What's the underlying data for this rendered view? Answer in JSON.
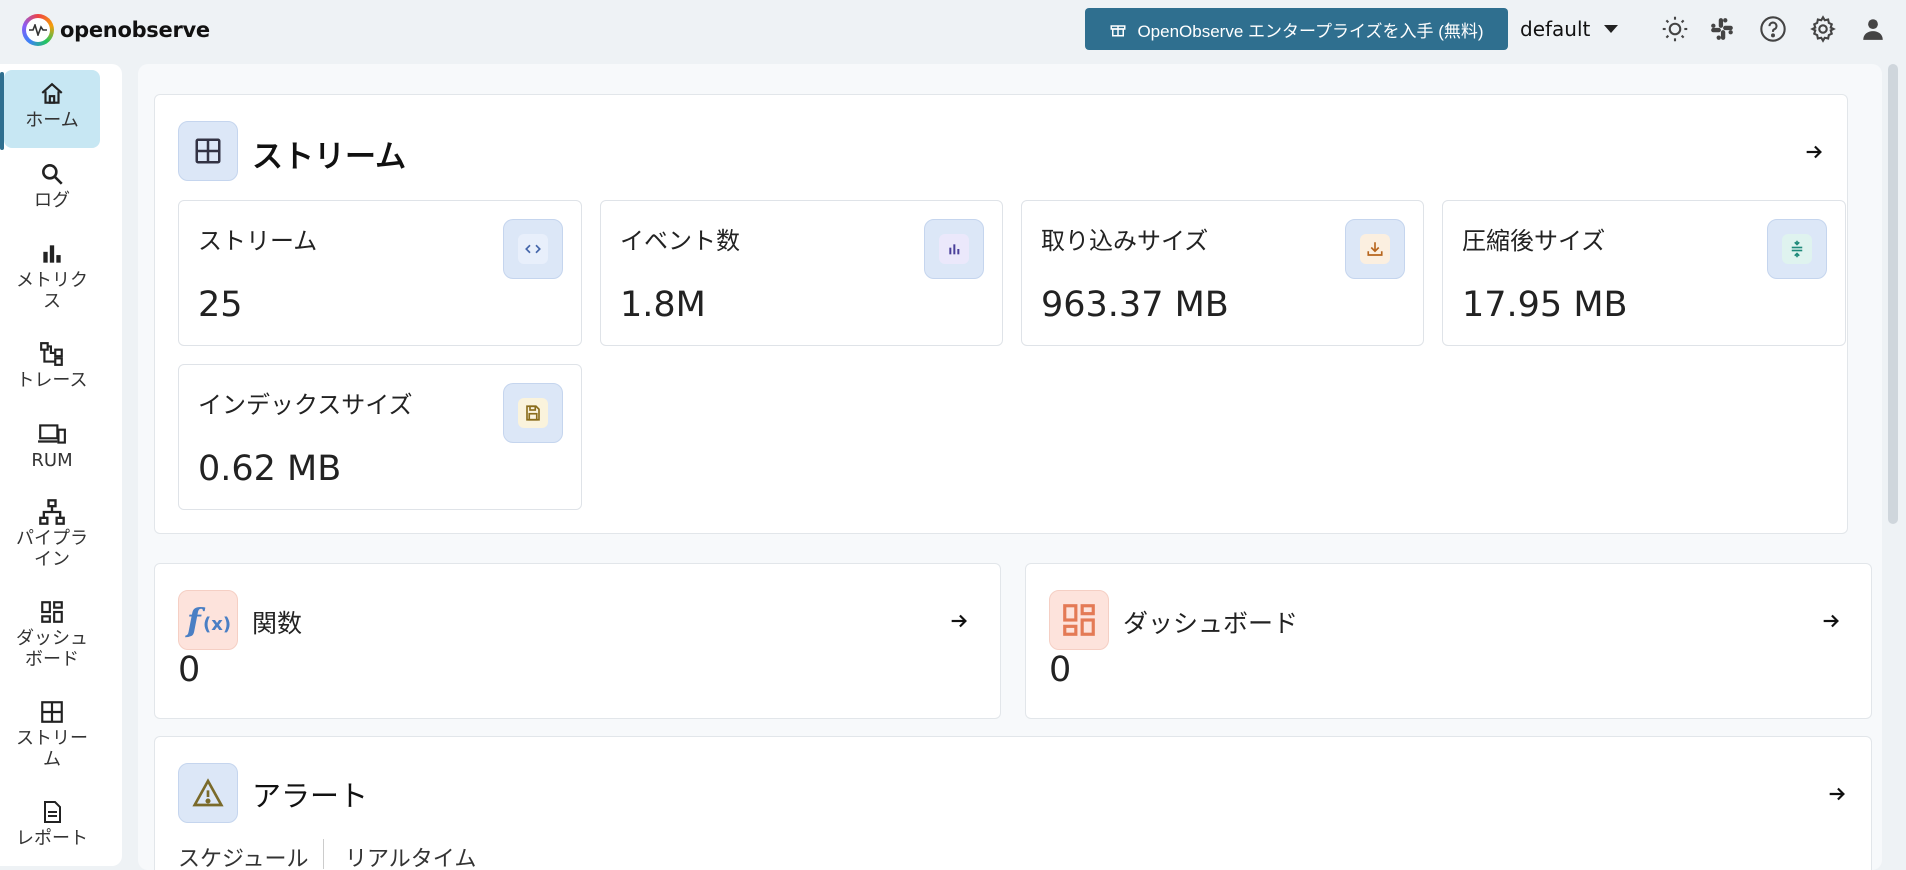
{
  "app": {
    "logo_text": "openobserve"
  },
  "header": {
    "enterprise_label": "OpenObserve エンタープライズを入手 (無料)",
    "org": "default"
  },
  "sidebar": {
    "items": [
      {
        "label": "ホーム",
        "icon": "home-icon",
        "active": true
      },
      {
        "label": "ログ",
        "icon": "search-icon"
      },
      {
        "label": "メトリクス",
        "icon": "bar-chart-icon"
      },
      {
        "label": "トレース",
        "icon": "trace-icon"
      },
      {
        "label": "RUM",
        "icon": "devices-icon"
      },
      {
        "label": "パイプライン",
        "icon": "pipeline-icon"
      },
      {
        "label": "ダッシュボード",
        "icon": "dashboard-icon"
      },
      {
        "label": "ストリーム",
        "icon": "grid-icon"
      },
      {
        "label": "レポート",
        "icon": "report-icon"
      }
    ]
  },
  "streams": {
    "title": "ストリーム",
    "stats": [
      {
        "label": "ストリーム",
        "value": "25",
        "icon": "code-icon"
      },
      {
        "label": "イベント数",
        "value": "1.8M",
        "icon": "bar-chart-icon"
      },
      {
        "label": "取り込みサイズ",
        "value": "963.37 MB",
        "icon": "download-tray-icon"
      },
      {
        "label": "圧縮後サイズ",
        "value": "17.95 MB",
        "icon": "compress-icon"
      },
      {
        "label": "インデックスサイズ",
        "value": "0.62 MB",
        "icon": "save-icon"
      }
    ]
  },
  "functions": {
    "title": "関数",
    "value": "0"
  },
  "dashboards": {
    "title": "ダッシュボード",
    "value": "0"
  },
  "alerts": {
    "title": "アラート",
    "tabs": [
      "スケジュール",
      "リアルタイム"
    ]
  },
  "colors": {
    "accent": "#2f6f8f",
    "active_nav": "#c7e7f3"
  }
}
